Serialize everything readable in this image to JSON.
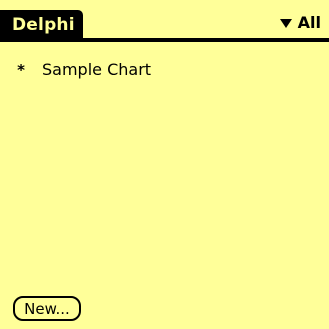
{
  "app": {
    "title": "Delphi"
  },
  "category_picker": {
    "selected": "All",
    "icon": "triangle-down-icon"
  },
  "documents": [
    {
      "icon": "asterisk-icon",
      "marker": "*",
      "label": "Sample Chart"
    }
  ],
  "footer": {
    "new_button_label": "New..."
  },
  "colors": {
    "background": "#ffff99",
    "foreground": "#000000"
  }
}
